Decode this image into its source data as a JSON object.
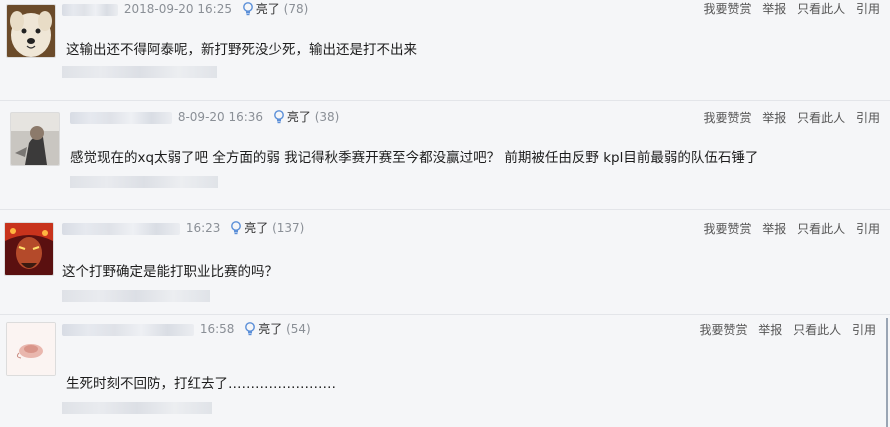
{
  "comments": [
    {
      "date": "2018-09-20 16:25",
      "liang": "亮了",
      "count": "(78)",
      "content": "这输出还不得阿泰呢，新打野死没少死，输出还是打不出来",
      "actions": [
        "我要赞赏",
        "举报",
        "只看此人",
        "引用"
      ]
    },
    {
      "date": "8-09-20 16:36",
      "liang": "亮了",
      "count": "(38)",
      "content": "感觉现在的xq太弱了吧 全方面的弱 我记得秋季赛开赛至今都没赢过吧？ 前期被任由反野 kpl目前最弱的队伍石锤了",
      "actions": [
        "我要赞赏",
        "举报",
        "只看此人",
        "引用"
      ]
    },
    {
      "date": "16:23",
      "liang": "亮了",
      "count": "(137)",
      "content": "这个打野确定是能打职业比赛的吗？",
      "actions": [
        "我要赞赏",
        "举报",
        "只看此人",
        "引用"
      ]
    },
    {
      "date": "16:58",
      "liang": "亮了",
      "count": "(54)",
      "content": "生死时刻不回防，打红去了……………………",
      "actions": [
        "我要赞赏",
        "举报",
        "只看此人",
        "引用"
      ]
    }
  ],
  "icons": {
    "bulb": "bulb-icon",
    "avatars": [
      "avatar-dog-icon",
      "avatar-person-icon",
      "avatar-hero-icon",
      "avatar-flower-icon"
    ]
  },
  "colors": {
    "background": "#f5f6f8",
    "meta_text": "#8a8f96",
    "action_text": "#555555",
    "bulb": "#5b8fd8"
  }
}
